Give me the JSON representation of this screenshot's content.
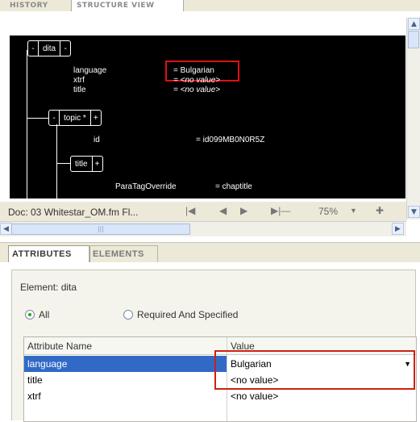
{
  "top_tabs": {
    "history": "HISTORY",
    "structure_view": "STRUCTURE VIEW"
  },
  "structure": {
    "root": {
      "name": "dita",
      "collapse": "-",
      "expand": "-"
    },
    "root_attributes": [
      {
        "name": "language",
        "value": "= Bulgarian",
        "highlighted": true
      },
      {
        "name": "xtrf",
        "value": "= <no value>"
      },
      {
        "name": "title",
        "value": "= <no value>"
      }
    ],
    "topic": {
      "name": "topic *",
      "collapse": "-",
      "expand": "+"
    },
    "topic_attributes": [
      {
        "name": "id",
        "value": "= id099MB0N0R5Z"
      }
    ],
    "title_node": {
      "name": "title",
      "expand": "+"
    },
    "title_attributes": [
      {
        "name": "ParaTagOverride",
        "value": "= chaptitle"
      }
    ]
  },
  "nav": {
    "doc": "Doc: 03 Whitestar_OM.fm Fl...",
    "first": "|◀",
    "prev": "◀",
    "next": "▶",
    "last": "▶|—",
    "zoom": "75%",
    "zoom_arrow": "▼",
    "add": "✚"
  },
  "bottom_tabs": {
    "attributes": "ATTRIBUTES",
    "elements": "ELEMENTS"
  },
  "attributes_panel": {
    "element_label": "Element: dita",
    "filter": {
      "all": "All",
      "required": "Required And Specified",
      "selected": "all"
    },
    "columns": {
      "name": "Attribute Name",
      "value": "Value"
    },
    "rows": [
      {
        "name": "language",
        "value": "Bulgarian",
        "selected": true
      },
      {
        "name": "title",
        "value": "<no value>"
      },
      {
        "name": "xtrf",
        "value": "<no value>"
      }
    ]
  },
  "colors": {
    "highlight": "#d11111",
    "selection": "#3169c6",
    "panel_bg": "#ece9d8"
  }
}
